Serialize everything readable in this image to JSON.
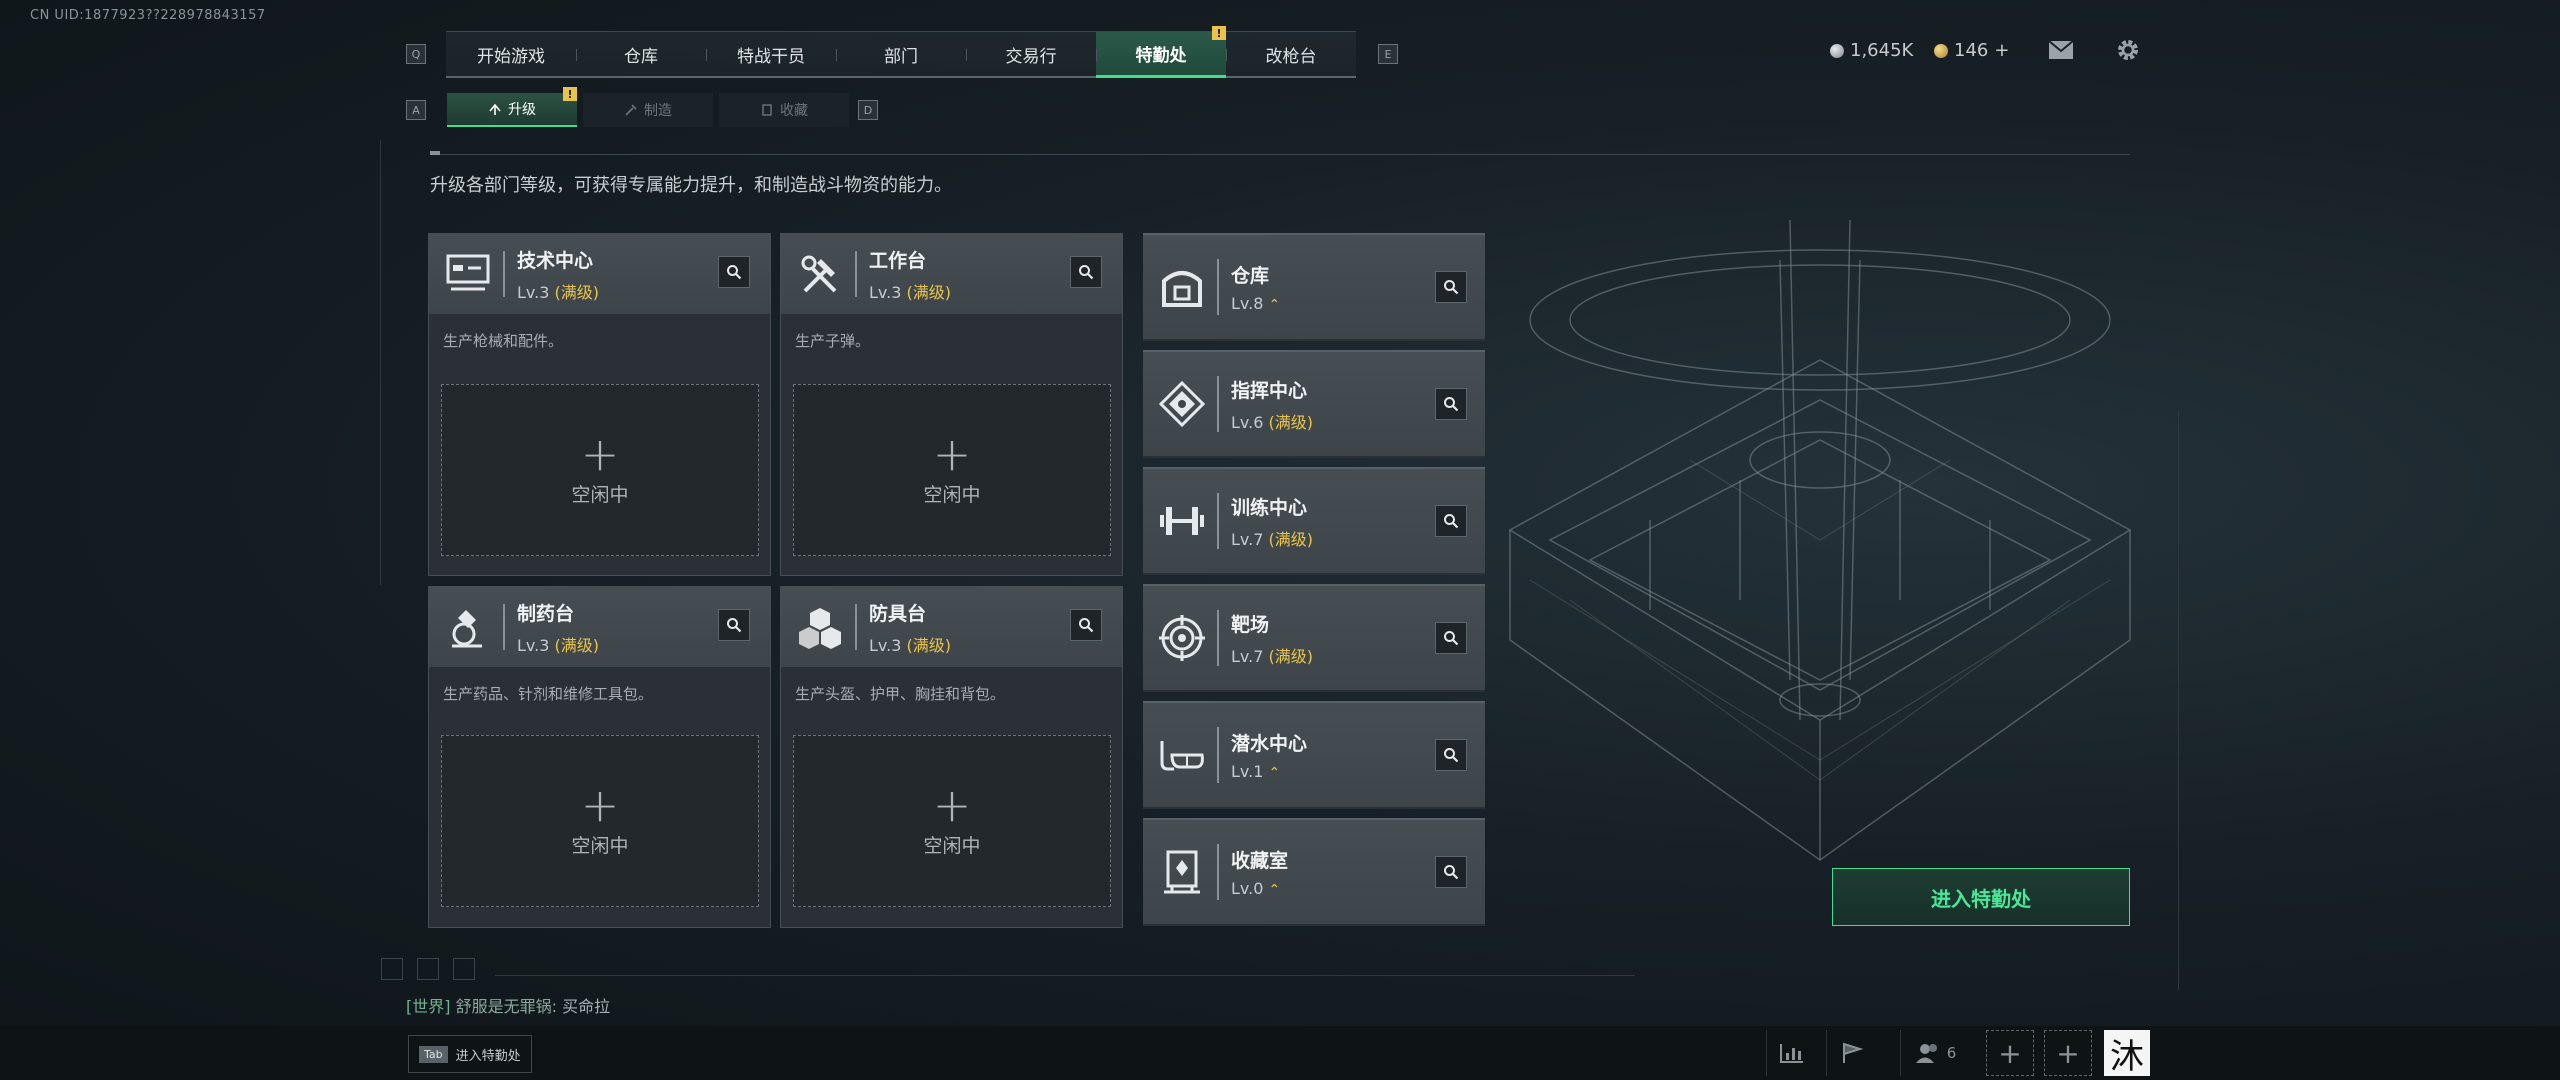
{
  "uid": "CN UID:1877923??228978843157",
  "topnav": {
    "left_key": "Q",
    "right_key": "E",
    "tabs": [
      {
        "label": "开始游戏",
        "active": false
      },
      {
        "label": "仓库",
        "active": false
      },
      {
        "label": "特战干员",
        "active": false
      },
      {
        "label": "部门",
        "active": false
      },
      {
        "label": "交易行",
        "active": false
      },
      {
        "label": "特勤处",
        "active": true,
        "badge": "!"
      },
      {
        "label": "改枪台",
        "active": false
      }
    ]
  },
  "subnav": {
    "left_key": "A",
    "right_key": "D",
    "tabs": [
      {
        "label": "升级",
        "active": true,
        "badge": "!"
      },
      {
        "label": "制造",
        "active": false
      },
      {
        "label": "收藏",
        "active": false
      }
    ]
  },
  "currency": {
    "silver": "1,645K",
    "gold": "146",
    "add": "+"
  },
  "description": "升级各部门等级，可获得专属能力提升，和制造战斗物资的能力。",
  "stations": [
    {
      "name": "技术中心",
      "level": "Lv.3",
      "max": "(满级)",
      "desc": "生产枪械和配件。",
      "slot_plus": "+",
      "slot_status": "空闲中",
      "icon": "computer-icon"
    },
    {
      "name": "工作台",
      "level": "Lv.3",
      "max": "(满级)",
      "desc": "生产子弹。",
      "slot_plus": "+",
      "slot_status": "空闲中",
      "icon": "tools-icon"
    },
    {
      "name": "制药台",
      "level": "Lv.3",
      "max": "(满级)",
      "desc": "生产药品、针剂和维修工具包。",
      "slot_plus": "+",
      "slot_status": "空闲中",
      "icon": "microscope-icon"
    },
    {
      "name": "防具台",
      "level": "Lv.3",
      "max": "(满级)",
      "desc": "生产头盔、护甲、胸挂和背包。",
      "slot_plus": "+",
      "slot_status": "空闲中",
      "icon": "cubes-icon"
    }
  ],
  "facilities": [
    {
      "name": "仓库",
      "level": "Lv.8",
      "max": "",
      "upgrade": true,
      "icon": "warehouse-icon"
    },
    {
      "name": "指挥中心",
      "level": "Lv.6",
      "max": "(满级)",
      "upgrade": false,
      "icon": "command-icon"
    },
    {
      "name": "训练中心",
      "level": "Lv.7",
      "max": "(满级)",
      "upgrade": false,
      "icon": "dumbbell-icon"
    },
    {
      "name": "靶场",
      "level": "Lv.7",
      "max": "(满级)",
      "upgrade": false,
      "icon": "target-icon"
    },
    {
      "name": "潜水中心",
      "level": "Lv.1",
      "max": "",
      "upgrade": true,
      "icon": "diving-icon"
    },
    {
      "name": "收藏室",
      "level": "Lv.0",
      "max": "",
      "upgrade": true,
      "icon": "collection-icon"
    }
  ],
  "enter_button": "进入特勤处",
  "chat": {
    "channel": "[世界]",
    "sender": "舒服是无罪锅:",
    "message": "买命拉"
  },
  "bottom": {
    "tab_key": "Tab",
    "tab_label": "进入特勤处",
    "friends_count": "6",
    "avatar_char": "沐"
  },
  "colors": {
    "accent_green": "#3ee08f",
    "gold": "#e9c449"
  }
}
